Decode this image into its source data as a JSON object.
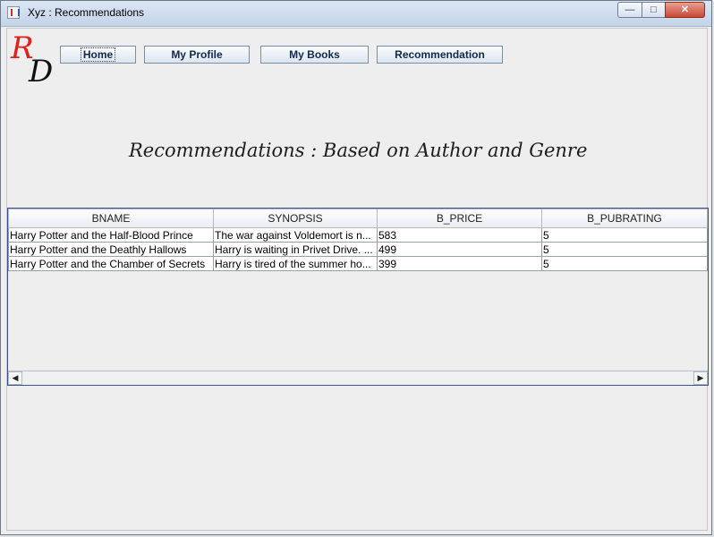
{
  "window": {
    "title": "Xyz : Recommendations",
    "controls": {
      "minimize": "—",
      "maximize": "□",
      "close": "✕"
    }
  },
  "logo": {
    "letters": [
      "R",
      "D"
    ],
    "colors": [
      "#e0201b",
      "#111111"
    ]
  },
  "nav": {
    "home": "Home",
    "profile": "My Profile",
    "books": "My Books",
    "recommendation": "Recommendation"
  },
  "heading": "Recommendations : Based on Author and Genre",
  "table": {
    "columns": [
      "BNAME",
      "SYNOPSIS",
      "B_PRICE",
      "B_PUBRATING"
    ],
    "rows": [
      [
        "Harry Potter and the Half-Blood Prince",
        "The war against Voldemort is n...",
        "583",
        "5"
      ],
      [
        "Harry Potter and the Deathly Hallows",
        "Harry is waiting in Privet Drive. ...",
        "499",
        "5"
      ],
      [
        "Harry Potter and the Chamber of Secrets",
        "Harry is tired of the summer ho...",
        "399",
        "5"
      ]
    ]
  },
  "scrollbar": {
    "left_arrow": "◀",
    "right_arrow": "▶"
  }
}
